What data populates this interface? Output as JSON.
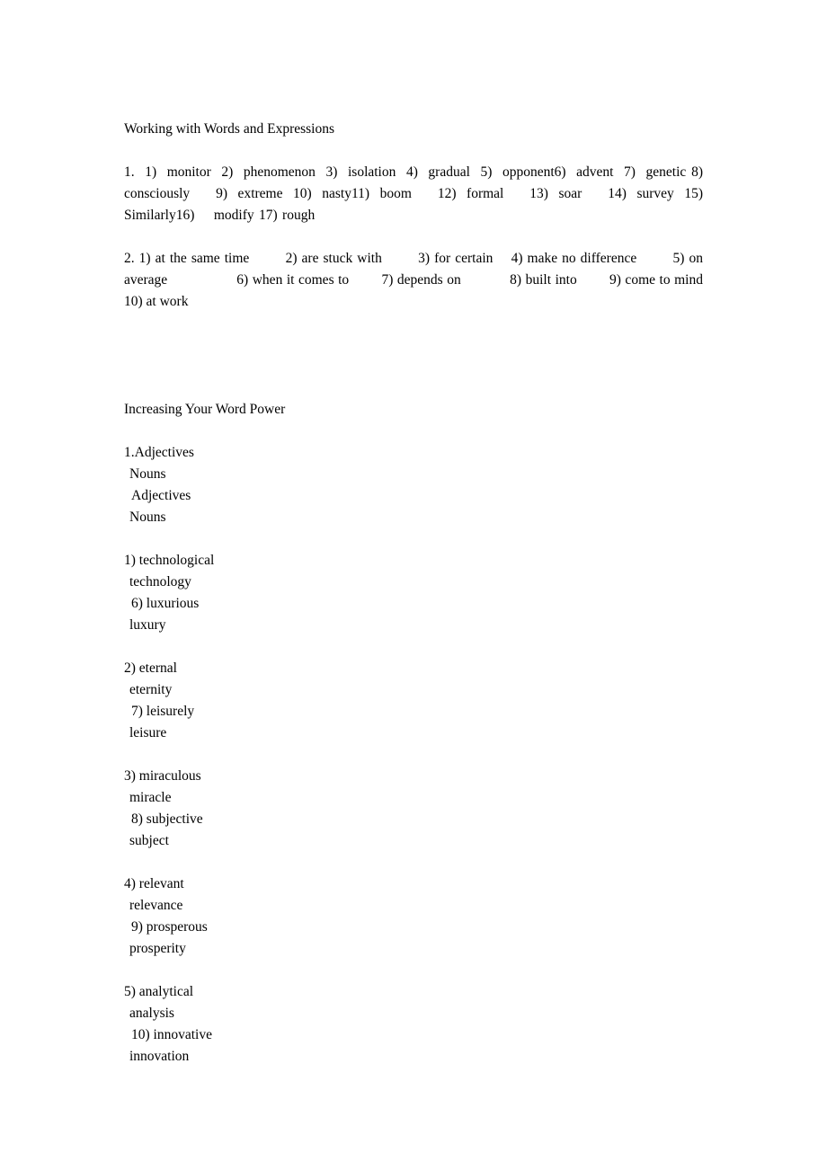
{
  "document": {
    "background_color": "#ffffff",
    "text_color": "#000000"
  },
  "sections": {
    "working_with_words": {
      "title": "Working with Words and Expressions",
      "item1": "1.  1)  monitor  2)  phenomenon  3)  isolation  4)  gradual  5)  opponent6)  advent  7)  genetic 8)  consciously     9)  extreme  10)  nasty11)  boom     12)  formal     13)  soar     14)  survey  15)  Similarly16)    modify 17) rough",
      "item2": "2. 1) at the same time        2) are stuck with        3) for certain    4) make no difference        5) on average                 6) when it comes to        7) depends on            8) built into        9) come to mind          10) at work"
    },
    "increasing_word_power": {
      "title": "Increasing Your Word Power",
      "header_block": {
        "number_label": "1.Adjectives",
        "lines": [
          "Nouns",
          "Adjectives",
          "Nouns"
        ]
      },
      "word_blocks": [
        {
          "adjective_left": "1) technological",
          "noun_left": "technology",
          "adjective_right": "6) luxurious",
          "noun_right": "luxury"
        },
        {
          "adjective_left": "2) eternal",
          "noun_left": "eternity",
          "adjective_right": "7) leisurely",
          "noun_right": "leisure"
        },
        {
          "adjective_left": "3) miraculous",
          "noun_left": "miracle",
          "adjective_right": "8) subjective",
          "noun_right": "subject"
        },
        {
          "adjective_left": "4) relevant",
          "noun_left": "relevance",
          "adjective_right": "9) prosperous",
          "noun_right": "prosperity"
        },
        {
          "adjective_left": "5) analytical",
          "noun_left": "analysis",
          "adjective_right": "10) innovative",
          "noun_right": "innovation"
        }
      ]
    }
  }
}
